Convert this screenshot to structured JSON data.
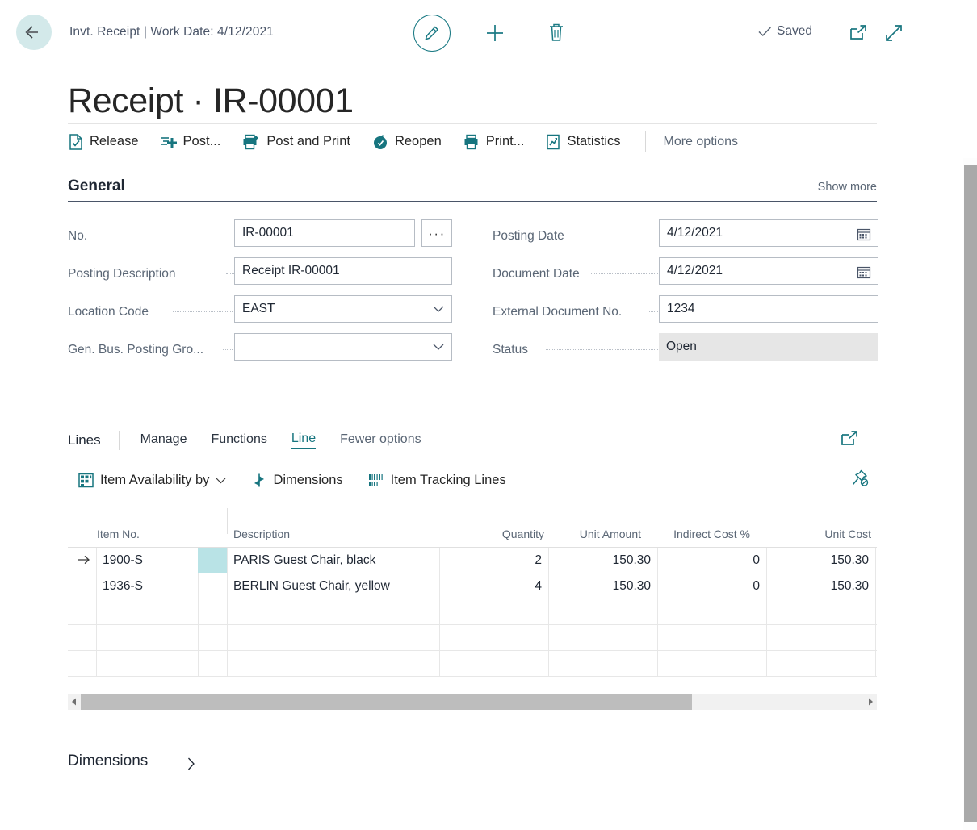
{
  "topbar": {
    "back_icon": "back-arrow-icon",
    "breadcrumb": "Invt. Receipt | Work Date: 4/12/2021",
    "edit_icon": "pencil-edit-icon",
    "new_icon": "plus-icon",
    "delete_icon": "trash-icon",
    "saved_label": "Saved",
    "saved_check_icon": "checkmark-icon",
    "open_new_window_icon": "open-in-new-window-icon",
    "expand_icon": "expand-diagonal-icon"
  },
  "title": "Receipt · IR-00001",
  "ribbon": {
    "items": [
      {
        "label": "Release",
        "icon": "release-document-icon"
      },
      {
        "label": "Post...",
        "icon": "post-plus-icon"
      },
      {
        "label": "Post and Print",
        "icon": "printer-plus-icon"
      },
      {
        "label": "Reopen",
        "icon": "reopen-clock-icon"
      },
      {
        "label": "Print...",
        "icon": "printer-icon"
      },
      {
        "label": "Statistics",
        "icon": "statistics-chart-icon"
      }
    ],
    "more_options": "More options"
  },
  "general": {
    "heading": "General",
    "show_more": "Show more",
    "left_fields": [
      {
        "label": "No.",
        "value": "IR-00001",
        "type": "text",
        "has_ellipsis": true
      },
      {
        "label": "Posting Description",
        "value": "Receipt IR-00001",
        "type": "text"
      },
      {
        "label": "Location Code",
        "value": "EAST",
        "type": "dropdown"
      },
      {
        "label": "Gen. Bus. Posting Gro...",
        "value": "",
        "type": "dropdown"
      }
    ],
    "right_fields": [
      {
        "label": "Posting Date",
        "value": "4/12/2021",
        "type": "date"
      },
      {
        "label": "Document Date",
        "value": "4/12/2021",
        "type": "date"
      },
      {
        "label": "External Document No.",
        "value": "1234",
        "type": "text"
      },
      {
        "label": "Status",
        "value": "Open",
        "type": "readonly"
      }
    ]
  },
  "lines": {
    "title": "Lines",
    "tabs": [
      {
        "label": "Manage",
        "active": false
      },
      {
        "label": "Functions",
        "active": false
      },
      {
        "label": "Line",
        "active": true
      },
      {
        "label": "Fewer options",
        "active": false,
        "muted": true
      }
    ],
    "open_new_window_icon": "open-in-new-window-icon",
    "actions": [
      {
        "label": "Item Availability by",
        "icon": "item-availability-icon",
        "has_caret": true
      },
      {
        "label": "Dimensions",
        "icon": "dimensions-icon",
        "has_caret": false
      },
      {
        "label": "Item Tracking Lines",
        "icon": "item-tracking-icon",
        "has_caret": false
      }
    ],
    "pin_icon": "unpin-icon"
  },
  "grid": {
    "columns": [
      "Item No.",
      "Description",
      "Quantity",
      "Unit Amount",
      "Indirect Cost %",
      "Unit Cost"
    ],
    "rows": [
      {
        "selected": true,
        "item_no": "1900-S",
        "description": "PARIS Guest Chair, black",
        "quantity": "2",
        "unit_amount": "150.30",
        "indirect_cost_pct": "0",
        "unit_cost": "150.30"
      },
      {
        "selected": false,
        "item_no": "1936-S",
        "description": "BERLIN Guest Chair, yellow",
        "quantity": "4",
        "unit_amount": "150.30",
        "indirect_cost_pct": "0",
        "unit_cost": "150.30"
      },
      {
        "selected": false,
        "item_no": "",
        "description": "",
        "quantity": "",
        "unit_amount": "",
        "indirect_cost_pct": "",
        "unit_cost": ""
      },
      {
        "selected": false,
        "item_no": "",
        "description": "",
        "quantity": "",
        "unit_amount": "",
        "indirect_cost_pct": "",
        "unit_cost": ""
      },
      {
        "selected": false,
        "item_no": "",
        "description": "",
        "quantity": "",
        "unit_amount": "",
        "indirect_cost_pct": "",
        "unit_cost": ""
      }
    ],
    "row_menu_icon": "row-options-kebab-icon",
    "selected_row_icon": "row-selected-arrow-icon"
  },
  "dimensions_section": {
    "title": "Dimensions",
    "chevron_icon": "chevron-right-icon"
  },
  "colors": {
    "accent_teal": "#17757f",
    "selection_teal": "#b9e3e6",
    "back_circle": "#d3e9ea",
    "readonly_gray": "#e6e6e6",
    "label_gray": "#5a6675"
  }
}
